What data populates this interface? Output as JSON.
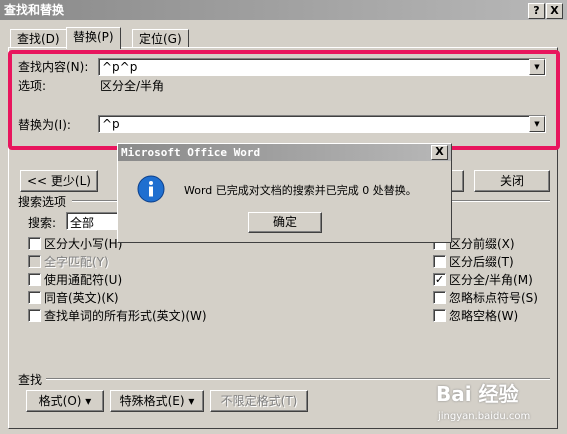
{
  "window": {
    "title": "查找和替换",
    "help_btn": "?",
    "close_btn": "X"
  },
  "tabs": [
    {
      "label": "查找(D)"
    },
    {
      "label": "替换(P)"
    },
    {
      "label": "定位(G)"
    }
  ],
  "find": {
    "label": "查找内容(N):",
    "value": "^p^p",
    "options_label": "选项:",
    "options_value": "区分全/半角"
  },
  "replace": {
    "label": "替换为(I):",
    "value": "^p"
  },
  "buttons": {
    "less": "<< 更少(L)",
    "close": "关闭",
    "format": "格式(O) ▾",
    "special": "特殊格式(E) ▾",
    "no_format": "不限定格式(T)"
  },
  "search_options": {
    "title": "搜索选项",
    "search_label": "搜索:",
    "search_value": "全部",
    "left": [
      {
        "label": "区分大小写(H)",
        "checked": false,
        "disabled": false
      },
      {
        "label": "全字匹配(Y)",
        "checked": false,
        "disabled": true
      },
      {
        "label": "使用通配符(U)",
        "checked": false,
        "disabled": false
      },
      {
        "label": "同音(英文)(K)",
        "checked": false,
        "disabled": false
      },
      {
        "label": "查找单词的所有形式(英文)(W)",
        "checked": false,
        "disabled": false
      }
    ],
    "right": [
      {
        "label": "区分前缀(X)",
        "checked": false,
        "disabled": false
      },
      {
        "label": "区分后缀(T)",
        "checked": false,
        "disabled": false
      },
      {
        "label": "区分全/半角(M)",
        "checked": true,
        "disabled": false
      },
      {
        "label": "忽略标点符号(S)",
        "checked": false,
        "disabled": false
      },
      {
        "label": "忽略空格(W)",
        "checked": false,
        "disabled": false
      }
    ]
  },
  "find_section": {
    "title": "查找"
  },
  "message": {
    "title": "Microsoft Office Word",
    "text": "Word 已完成对文档的搜索并已完成 0 处替换。",
    "ok": "确定",
    "close_btn": "X"
  },
  "watermark": {
    "logo": "Bai 经验",
    "url": "jingyan.baidu.com"
  },
  "colors": {
    "highlight": "#e8155d",
    "face": "#d4d0c8",
    "info_icon": "#1f6fd0"
  }
}
